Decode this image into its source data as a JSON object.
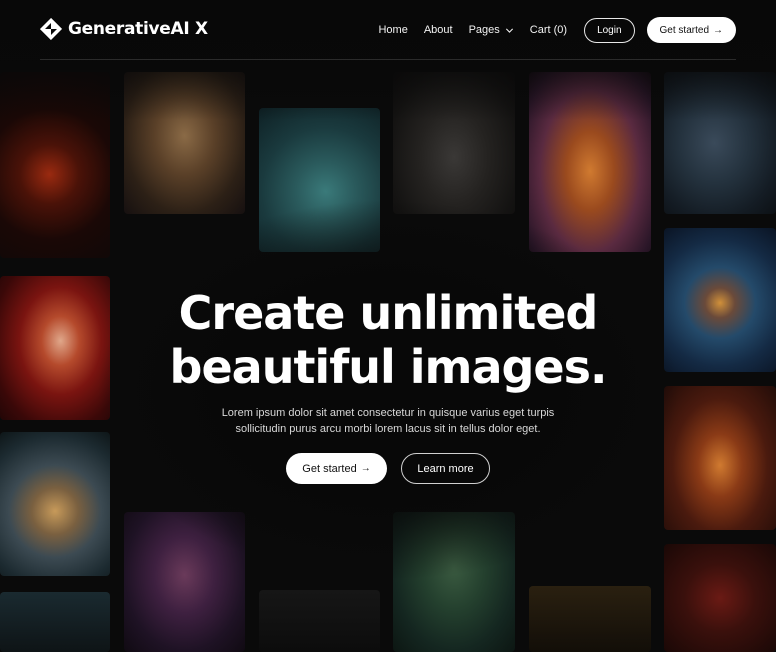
{
  "brand": {
    "name": "GenerativeAI X"
  },
  "nav": {
    "items": [
      {
        "label": "Home"
      },
      {
        "label": "About"
      },
      {
        "label": "Pages"
      },
      {
        "label": "Cart (0)"
      }
    ],
    "login_label": "Login",
    "cta_label": "Get started",
    "arrow": "→"
  },
  "hero": {
    "title_line1": "Create unlimited",
    "title_line2": "beautiful images.",
    "subtitle_line1": "Lorem ipsum dolor sit amet consectetur in quisque varius eget turpis",
    "subtitle_line2": "sollicitudin purus arcu morbi lorem lacus sit in tellus dolor eget.",
    "primary_label": "Get started",
    "secondary_label": "Learn more"
  },
  "colors": {
    "background": "#0a0a0a",
    "text": "#ffffff",
    "button_light": "#ffffff",
    "button_dark_text": "#111111"
  },
  "icons": {
    "logo": "diamond-logo-icon",
    "pages_dropdown": "chevron-down-icon",
    "cta_arrow": "arrow-right-icon"
  }
}
